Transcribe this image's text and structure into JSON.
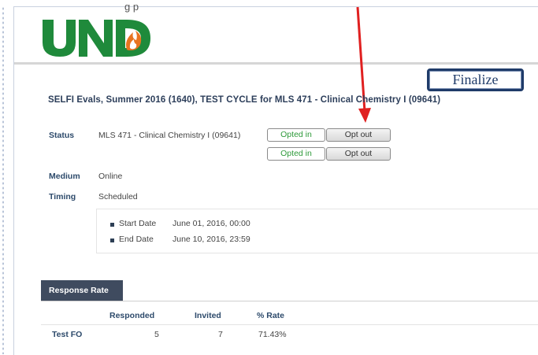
{
  "header": {
    "logo_text": "UND",
    "partial_text": "g                   p"
  },
  "finalize_label": "Finalize",
  "eval_title": "SELFI Evals, Summer 2016 (1640), TEST CYCLE for MLS 471 - Clinical Chemistry I (09641)",
  "status": {
    "label": "Status",
    "course": "MLS 471 - Clinical Chemistry I (09641)",
    "rows": [
      {
        "opted_label": "Opted in",
        "optout_label": "Opt out"
      },
      {
        "opted_label": "Opted in",
        "optout_label": "Opt out"
      }
    ]
  },
  "medium": {
    "label": "Medium",
    "value": "Online"
  },
  "timing": {
    "label": "Timing",
    "value": "Scheduled"
  },
  "dates": {
    "start_label": "Start Date",
    "start_value": "June 01, 2016, 00:00",
    "end_label": "End Date",
    "end_value": "June 10, 2016, 23:59"
  },
  "response_rate": {
    "tab_label": "Response Rate",
    "columns": [
      "Responded",
      "Invited",
      "% Rate"
    ],
    "rows": [
      {
        "name": "Test FO",
        "responded": "5",
        "invited": "7",
        "rate": "71.43%"
      }
    ]
  },
  "colors": {
    "und_green": "#1f8a3b",
    "flame_orange": "#e8741f",
    "finalize_border": "#1f3b69",
    "arrow_red": "#e02020",
    "tab_bg": "#3f4b5f"
  }
}
